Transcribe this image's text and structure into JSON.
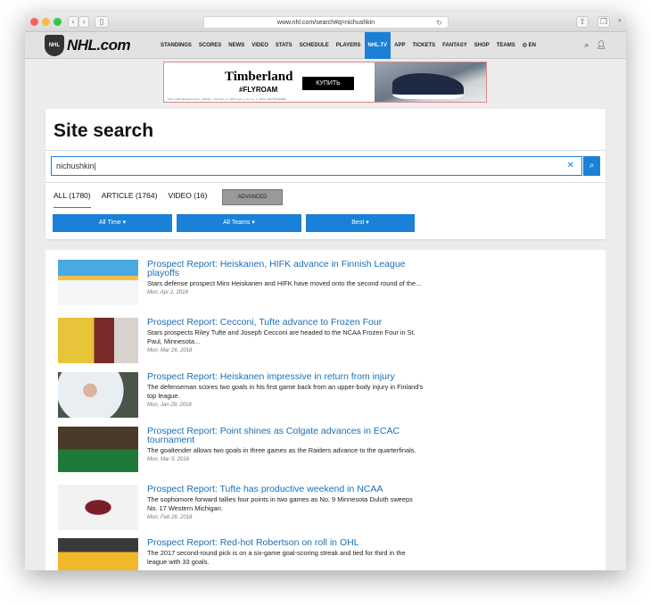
{
  "browser": {
    "url": "www.nhl.com/search#q=nichushkin"
  },
  "nav": {
    "logo": "NHL.com",
    "items": [
      "STANDINGS",
      "SCORES",
      "NEWS",
      "VIDEO",
      "STATS",
      "SCHEDULE",
      "PLAYERS",
      "NHL.TV",
      "APP",
      "TICKETS",
      "FANTASY",
      "SHOP",
      "TEAMS",
      "◎ EN"
    ],
    "active": "NHL.TV"
  },
  "ad": {
    "brand": "Timberland",
    "tag": "#FLYROAM",
    "cta": "КУПИТЬ",
    "fine": "ЗАО «ИНН Джамильская», 125022, г. Москва, ул. 1905 года, д. 10, стр. 1. ОГРН 1027700049486"
  },
  "search": {
    "title": "Site search",
    "query": "nichushkin",
    "tabs": [
      "ALL (1780)",
      "ARTICLE (1764)",
      "VIDEO (16)"
    ],
    "advanced": "ADVANCED",
    "filters": [
      "All Time ▾",
      "All Teams ▾",
      "Best ▾"
    ]
  },
  "results": [
    {
      "title": "Prospect Report: Heiskanen, HIFK advance in Finnish League playoffs",
      "desc": "Stars defense prospect Miro Heiskanen and HIFK have moved onto the second round of the...",
      "date": "Mon, Apr 2, 2018"
    },
    {
      "title": "Prospect Report: Cecconi, Tufte advance to Frozen Four",
      "desc": "Stars prospects Riley Tufte and Joseph Cecconi are headed to the NCAA Frozen Four in St. Paul, Minnesota...",
      "date": "Mon, Mar 26, 2018"
    },
    {
      "title": "Prospect Report: Heiskanen impressive in return from injury",
      "desc": "The defenseman scores two goals in his first game back from an upper-body injury in Finland's top league.",
      "date": "Mon, Jan 29, 2018"
    },
    {
      "title": "Prospect Report: Point shines as Colgate advances in ECAC tournament",
      "desc": "The goaltender allows two goals in three games as the Raiders advance to the quarterfinals.",
      "date": "Mon, Mar 5, 2018"
    },
    {
      "title": "Prospect Report: Tufte has productive weekend in NCAA",
      "desc": "The sophomore forward tallies four points in two games as No. 9 Minnesota Duluth sweeps No. 17 Western Michigan.",
      "date": "Mon, Feb 26, 2018"
    },
    {
      "title": "Prospect Report: Red-hot Robertson on roll in OHL",
      "desc": "The 2017 second-round pick is on a six-game goal-scoring streak and tied for third in the league with 33 goals.",
      "date": ""
    }
  ]
}
